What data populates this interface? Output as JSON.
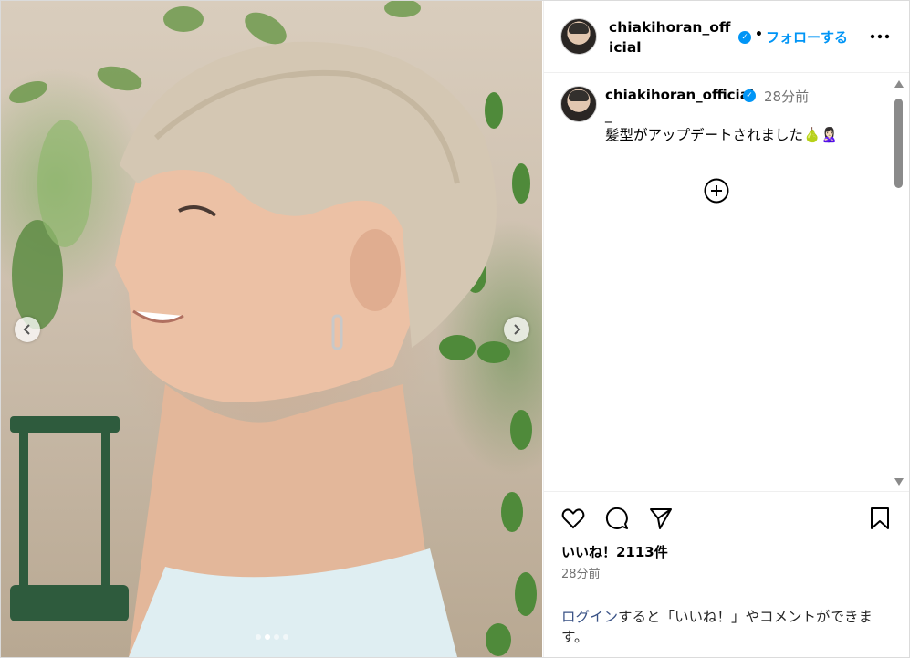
{
  "post": {
    "username": "chiakihoran_official",
    "follow_label": "フォローする",
    "separator": "•",
    "verified_mark": "✓",
    "more_icon": "ellipsis-icon"
  },
  "caption": {
    "username": "chiakihoran_official",
    "time_ago": "28分前",
    "dash": "_",
    "text": "髪型がアップデートされました🍐🙎🏻‍♀️"
  },
  "carousel": {
    "current_index": 2,
    "total": 4
  },
  "actions": {
    "likes_text": "いいね！2113件",
    "post_time": "28分前"
  },
  "login_prompt": {
    "link_text": "ログイン",
    "rest_text": "すると「いいね！」やコメントができます。"
  },
  "colors": {
    "accent": "#0095f6",
    "link": "#385185",
    "muted": "#737373",
    "border": "#efefef"
  }
}
